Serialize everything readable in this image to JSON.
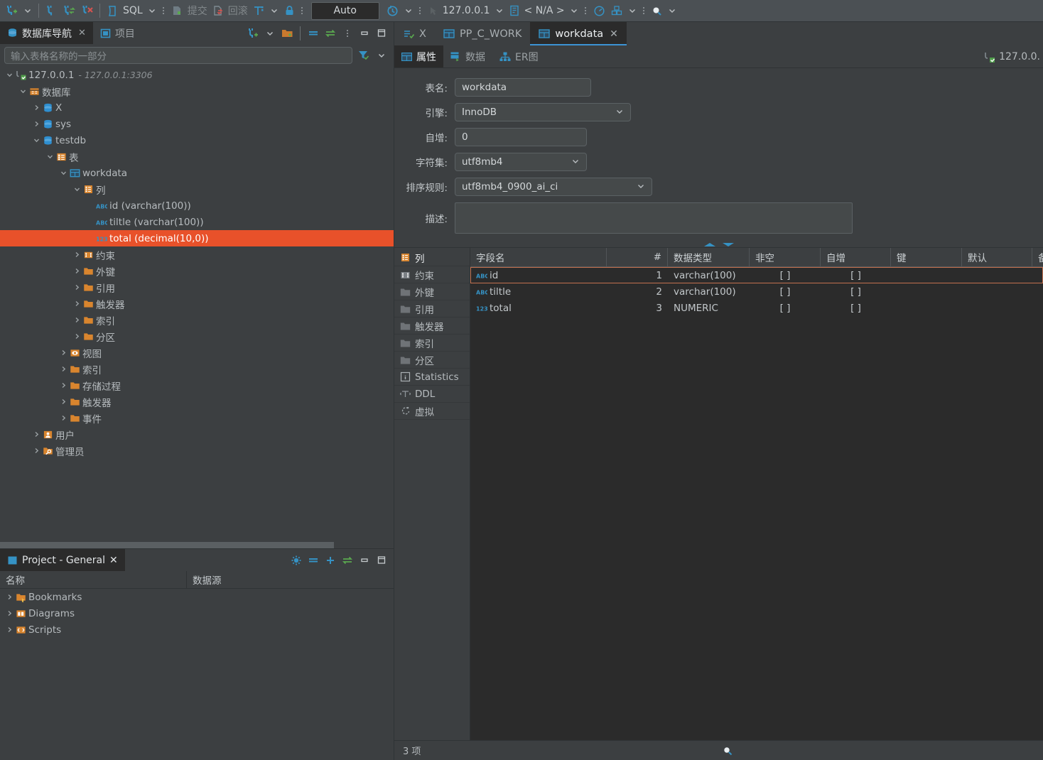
{
  "toolbar": {
    "sql_label": "SQL",
    "commit_label": "提交",
    "rollback_label": "回滚",
    "auto_label": "Auto",
    "host_label": "127.0.0.1",
    "schema_label": "< N/A >",
    "icons": [
      "new-connection-icon",
      "connect-icon",
      "reconnect-icon",
      "disconnect-icon",
      "sql-editor-icon",
      "commit-icon",
      "rollback-icon",
      "transaction-mode-icon",
      "lock-icon",
      "history-icon",
      "sql-script-icon",
      "database-selector-icon",
      "performance-icon",
      "package-icon",
      "search-icon"
    ]
  },
  "left_panel": {
    "tabs": [
      {
        "label": "数据库导航",
        "icon": "database-navigator-icon",
        "active": true,
        "closable": true
      },
      {
        "label": "项目",
        "icon": "project-icon",
        "active": false,
        "closable": false
      }
    ],
    "filter": {
      "placeholder": "输入表格名称的一部分",
      "value": ""
    },
    "tree": [
      {
        "indent": 0,
        "twisty": "down",
        "icon": "connection-icon",
        "label": "127.0.0.1",
        "sub": "127.0.0.1:3306",
        "selected": false
      },
      {
        "indent": 1,
        "twisty": "down",
        "icon": "databases-icon",
        "label": "数据库",
        "sub": "",
        "selected": false
      },
      {
        "indent": 2,
        "twisty": "right",
        "icon": "database-icon",
        "label": "X",
        "sub": "",
        "selected": false
      },
      {
        "indent": 2,
        "twisty": "right",
        "icon": "database-icon",
        "label": "sys",
        "sub": "",
        "selected": false
      },
      {
        "indent": 2,
        "twisty": "down",
        "icon": "database-icon",
        "label": "testdb",
        "sub": "",
        "selected": false
      },
      {
        "indent": 3,
        "twisty": "down",
        "icon": "tables-folder-icon",
        "label": "表",
        "sub": "",
        "selected": false
      },
      {
        "indent": 4,
        "twisty": "down",
        "icon": "table-icon",
        "label": "workdata",
        "sub": "",
        "selected": false
      },
      {
        "indent": 5,
        "twisty": "down",
        "icon": "columns-folder-icon",
        "label": "列",
        "sub": "",
        "selected": false
      },
      {
        "indent": 6,
        "twisty": "none",
        "icon": "string-column-icon",
        "label": "id (varchar(100))",
        "sub": "",
        "selected": false
      },
      {
        "indent": 6,
        "twisty": "none",
        "icon": "string-column-icon",
        "label": "tiltle (varchar(100))",
        "sub": "",
        "selected": false
      },
      {
        "indent": 6,
        "twisty": "none",
        "icon": "numeric-column-icon",
        "label": "total (decimal(10,0))",
        "sub": "",
        "selected": true
      },
      {
        "indent": 5,
        "twisty": "right",
        "icon": "constraints-icon",
        "label": "约束",
        "sub": "",
        "selected": false
      },
      {
        "indent": 5,
        "twisty": "right",
        "icon": "folder-icon",
        "label": "外键",
        "sub": "",
        "selected": false
      },
      {
        "indent": 5,
        "twisty": "right",
        "icon": "folder-icon",
        "label": "引用",
        "sub": "",
        "selected": false
      },
      {
        "indent": 5,
        "twisty": "right",
        "icon": "folder-icon",
        "label": "触发器",
        "sub": "",
        "selected": false
      },
      {
        "indent": 5,
        "twisty": "right",
        "icon": "folder-icon",
        "label": "索引",
        "sub": "",
        "selected": false
      },
      {
        "indent": 5,
        "twisty": "right",
        "icon": "folder-icon",
        "label": "分区",
        "sub": "",
        "selected": false
      },
      {
        "indent": 4,
        "twisty": "right",
        "icon": "views-icon",
        "label": "视图",
        "sub": "",
        "selected": false
      },
      {
        "indent": 4,
        "twisty": "right",
        "icon": "folder-icon",
        "label": "索引",
        "sub": "",
        "selected": false
      },
      {
        "indent": 4,
        "twisty": "right",
        "icon": "folder-icon",
        "label": "存储过程",
        "sub": "",
        "selected": false
      },
      {
        "indent": 4,
        "twisty": "right",
        "icon": "folder-icon",
        "label": "触发器",
        "sub": "",
        "selected": false
      },
      {
        "indent": 4,
        "twisty": "right",
        "icon": "folder-icon",
        "label": "事件",
        "sub": "",
        "selected": false
      },
      {
        "indent": 2,
        "twisty": "right",
        "icon": "users-icon",
        "label": "用户",
        "sub": "",
        "selected": false
      },
      {
        "indent": 2,
        "twisty": "right",
        "icon": "admin-icon",
        "label": "管理员",
        "sub": "",
        "selected": false
      }
    ]
  },
  "project_panel": {
    "tab_label": "Project - General",
    "columns": [
      "名称",
      "数据源"
    ],
    "rows": [
      {
        "label": "Bookmarks",
        "icon": "bookmarks-folder-icon",
        "datasource": ""
      },
      {
        "label": "Diagrams",
        "icon": "diagrams-folder-icon",
        "datasource": ""
      },
      {
        "label": "Scripts",
        "icon": "scripts-folder-icon",
        "datasource": ""
      }
    ]
  },
  "editor": {
    "tabs": [
      {
        "label": "X",
        "icon": "sql-console-icon",
        "active": false,
        "closable": false
      },
      {
        "label": "PP_C_WORK",
        "icon": "table-icon",
        "active": false,
        "closable": false
      },
      {
        "label": "workdata",
        "icon": "table-icon",
        "active": true,
        "closable": true
      }
    ],
    "subtabs": [
      {
        "label": "属性",
        "icon": "properties-icon",
        "active": true
      },
      {
        "label": "数据",
        "icon": "data-grid-icon",
        "active": false
      },
      {
        "label": "ER图",
        "icon": "er-diagram-icon",
        "active": false
      }
    ],
    "connection_label": "127.0.0.",
    "form": {
      "table_name_label": "表名:",
      "table_name_value": "workdata",
      "engine_label": "引擎:",
      "engine_value": "InnoDB",
      "auto_increment_label": "自增:",
      "auto_increment_value": "0",
      "charset_label": "字符集:",
      "charset_value": "utf8mb4",
      "collation_label": "排序规则:",
      "collation_value": "utf8mb4_0900_ai_ci",
      "description_label": "描述:",
      "description_value": ""
    },
    "object_list": [
      {
        "label": "列",
        "icon": "columns-folder-icon",
        "active": true
      },
      {
        "label": "约束",
        "icon": "constraints-icon",
        "active": false
      },
      {
        "label": "外键",
        "icon": "folder-icon",
        "active": false
      },
      {
        "label": "引用",
        "icon": "folder-icon",
        "active": false
      },
      {
        "label": "触发器",
        "icon": "folder-icon",
        "active": false
      },
      {
        "label": "索引",
        "icon": "folder-icon",
        "active": false
      },
      {
        "label": "分区",
        "icon": "folder-icon",
        "active": false
      },
      {
        "label": "Statistics",
        "icon": "info-icon",
        "active": false
      },
      {
        "label": "DDL",
        "icon": "ddl-icon",
        "active": false
      },
      {
        "label": "虚拟",
        "icon": "virtual-icon",
        "active": false
      }
    ],
    "grid": {
      "columns": [
        "字段名",
        "#",
        "数据类型",
        "非空",
        "自增",
        "键",
        "默认",
        "备"
      ],
      "rows": [
        {
          "icon": "string-column-icon",
          "name": "id",
          "num": "1",
          "type": "varchar(100)",
          "not_null": "[ ]",
          "auto_inc": "[ ]",
          "key": "",
          "default": "",
          "selected": true
        },
        {
          "icon": "string-column-icon",
          "name": "tiltle",
          "num": "2",
          "type": "varchar(100)",
          "not_null": "[ ]",
          "auto_inc": "[ ]",
          "key": "",
          "default": "",
          "selected": false
        },
        {
          "icon": "numeric-column-icon",
          "name": "total",
          "num": "3",
          "type": "NUMERIC",
          "not_null": "[ ]",
          "auto_inc": "[ ]",
          "key": "",
          "default": "",
          "selected": false
        }
      ]
    }
  },
  "status_bar": {
    "count_label": "3 项",
    "search_icon": "search-icon"
  },
  "colors": {
    "selection": "#e8512a",
    "accent": "#3c93d4",
    "folder": "#d99133",
    "panel_bg": "#3c3f41",
    "editor_bg": "#2b2b2b"
  }
}
